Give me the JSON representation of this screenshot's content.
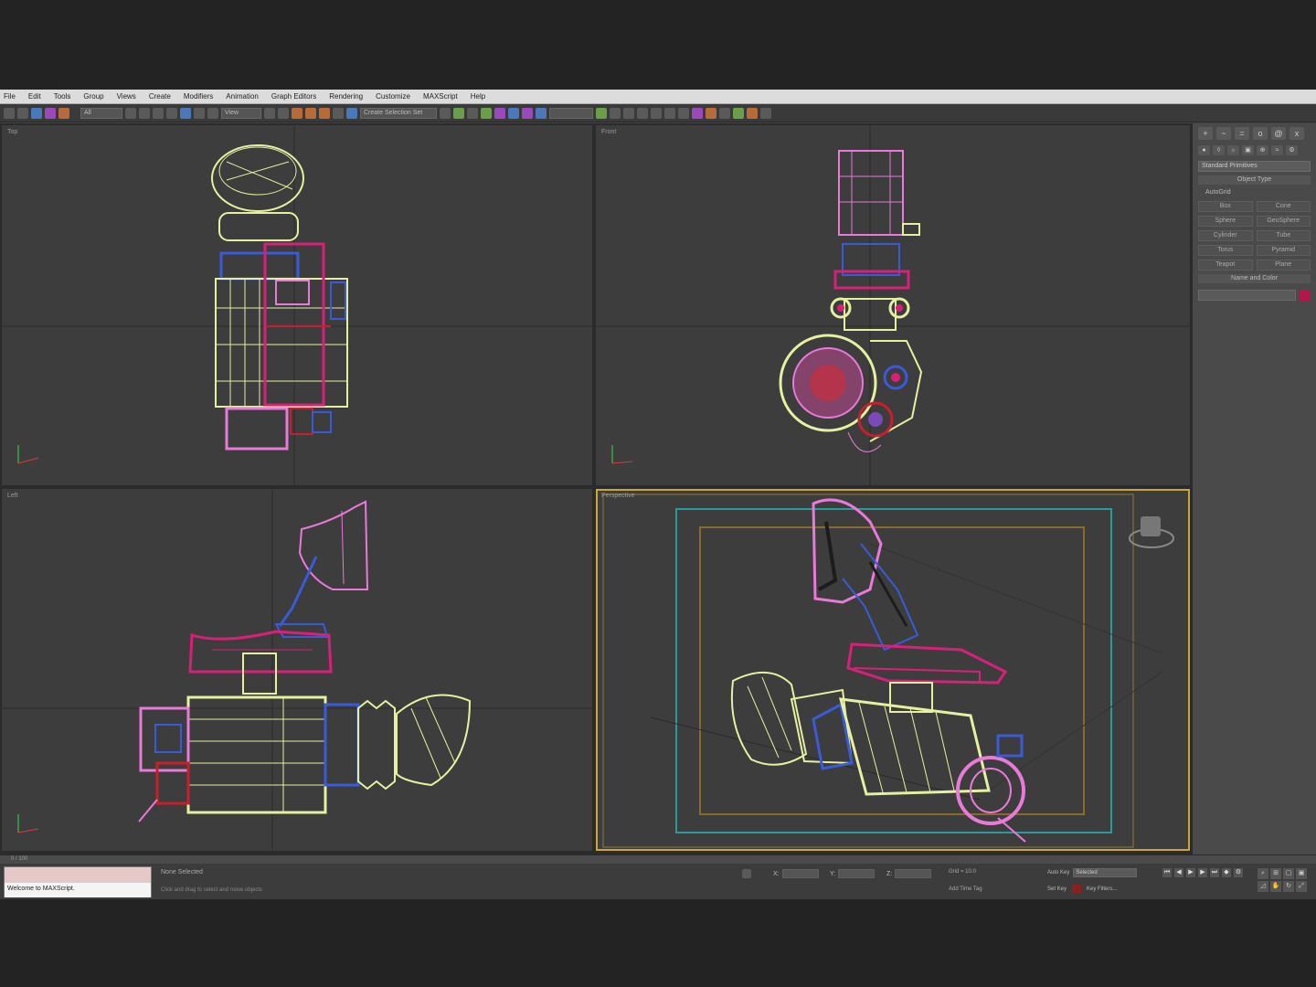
{
  "menubar": {
    "items": [
      "File",
      "Edit",
      "Tools",
      "Group",
      "Views",
      "Create",
      "Modifiers",
      "Animation",
      "Graph Editors",
      "Rendering",
      "Customize",
      "MAXScript",
      "Help"
    ]
  },
  "toolbar": {
    "selection_filter": "All",
    "reference_coord": "View",
    "named_selection": "Create Selection Set"
  },
  "viewports": {
    "top_label": "Top",
    "front_label": "Front",
    "left_label": "Left",
    "perspective_label": "Perspective"
  },
  "command_panel": {
    "tabs": [
      "+",
      "~",
      "=",
      "o",
      "@",
      "x"
    ],
    "category": "Standard Primitives",
    "rollout_object_type": "Object Type",
    "autogrid": "AutoGrid",
    "object_buttons": [
      "Box",
      "Cone",
      "Sphere",
      "GeoSphere",
      "Cylinder",
      "Tube",
      "Torus",
      "Pyramid",
      "Teapot",
      "Plane"
    ],
    "rollout_name_color": "Name and Color",
    "object_color": "#b0184c"
  },
  "statusbar": {
    "timeline_start": "0 / 100",
    "maxscript_prompt": "Welcome to MAXScript.",
    "selection_status": "None Selected",
    "prompt_hint": "Click and drag to select and move objects",
    "coord_x_label": "X:",
    "coord_y_label": "Y:",
    "coord_z_label": "Z:",
    "grid_text": "Grid = 10.0",
    "add_time_tag": "Add Time Tag",
    "auto_key_label": "Auto Key",
    "auto_key_value": "Selected",
    "set_key_label": "Set Key",
    "key_filters": "Key Filters..."
  },
  "colors": {
    "wire_yellow": "#e6f0a0",
    "wire_pink": "#e87ad8",
    "wire_magenta": "#d8207a",
    "wire_blue": "#3a5ad8",
    "wire_red": "#c81e2e",
    "active_border": "#c8a83a",
    "safe_frame_teal": "#2a9a9a"
  }
}
